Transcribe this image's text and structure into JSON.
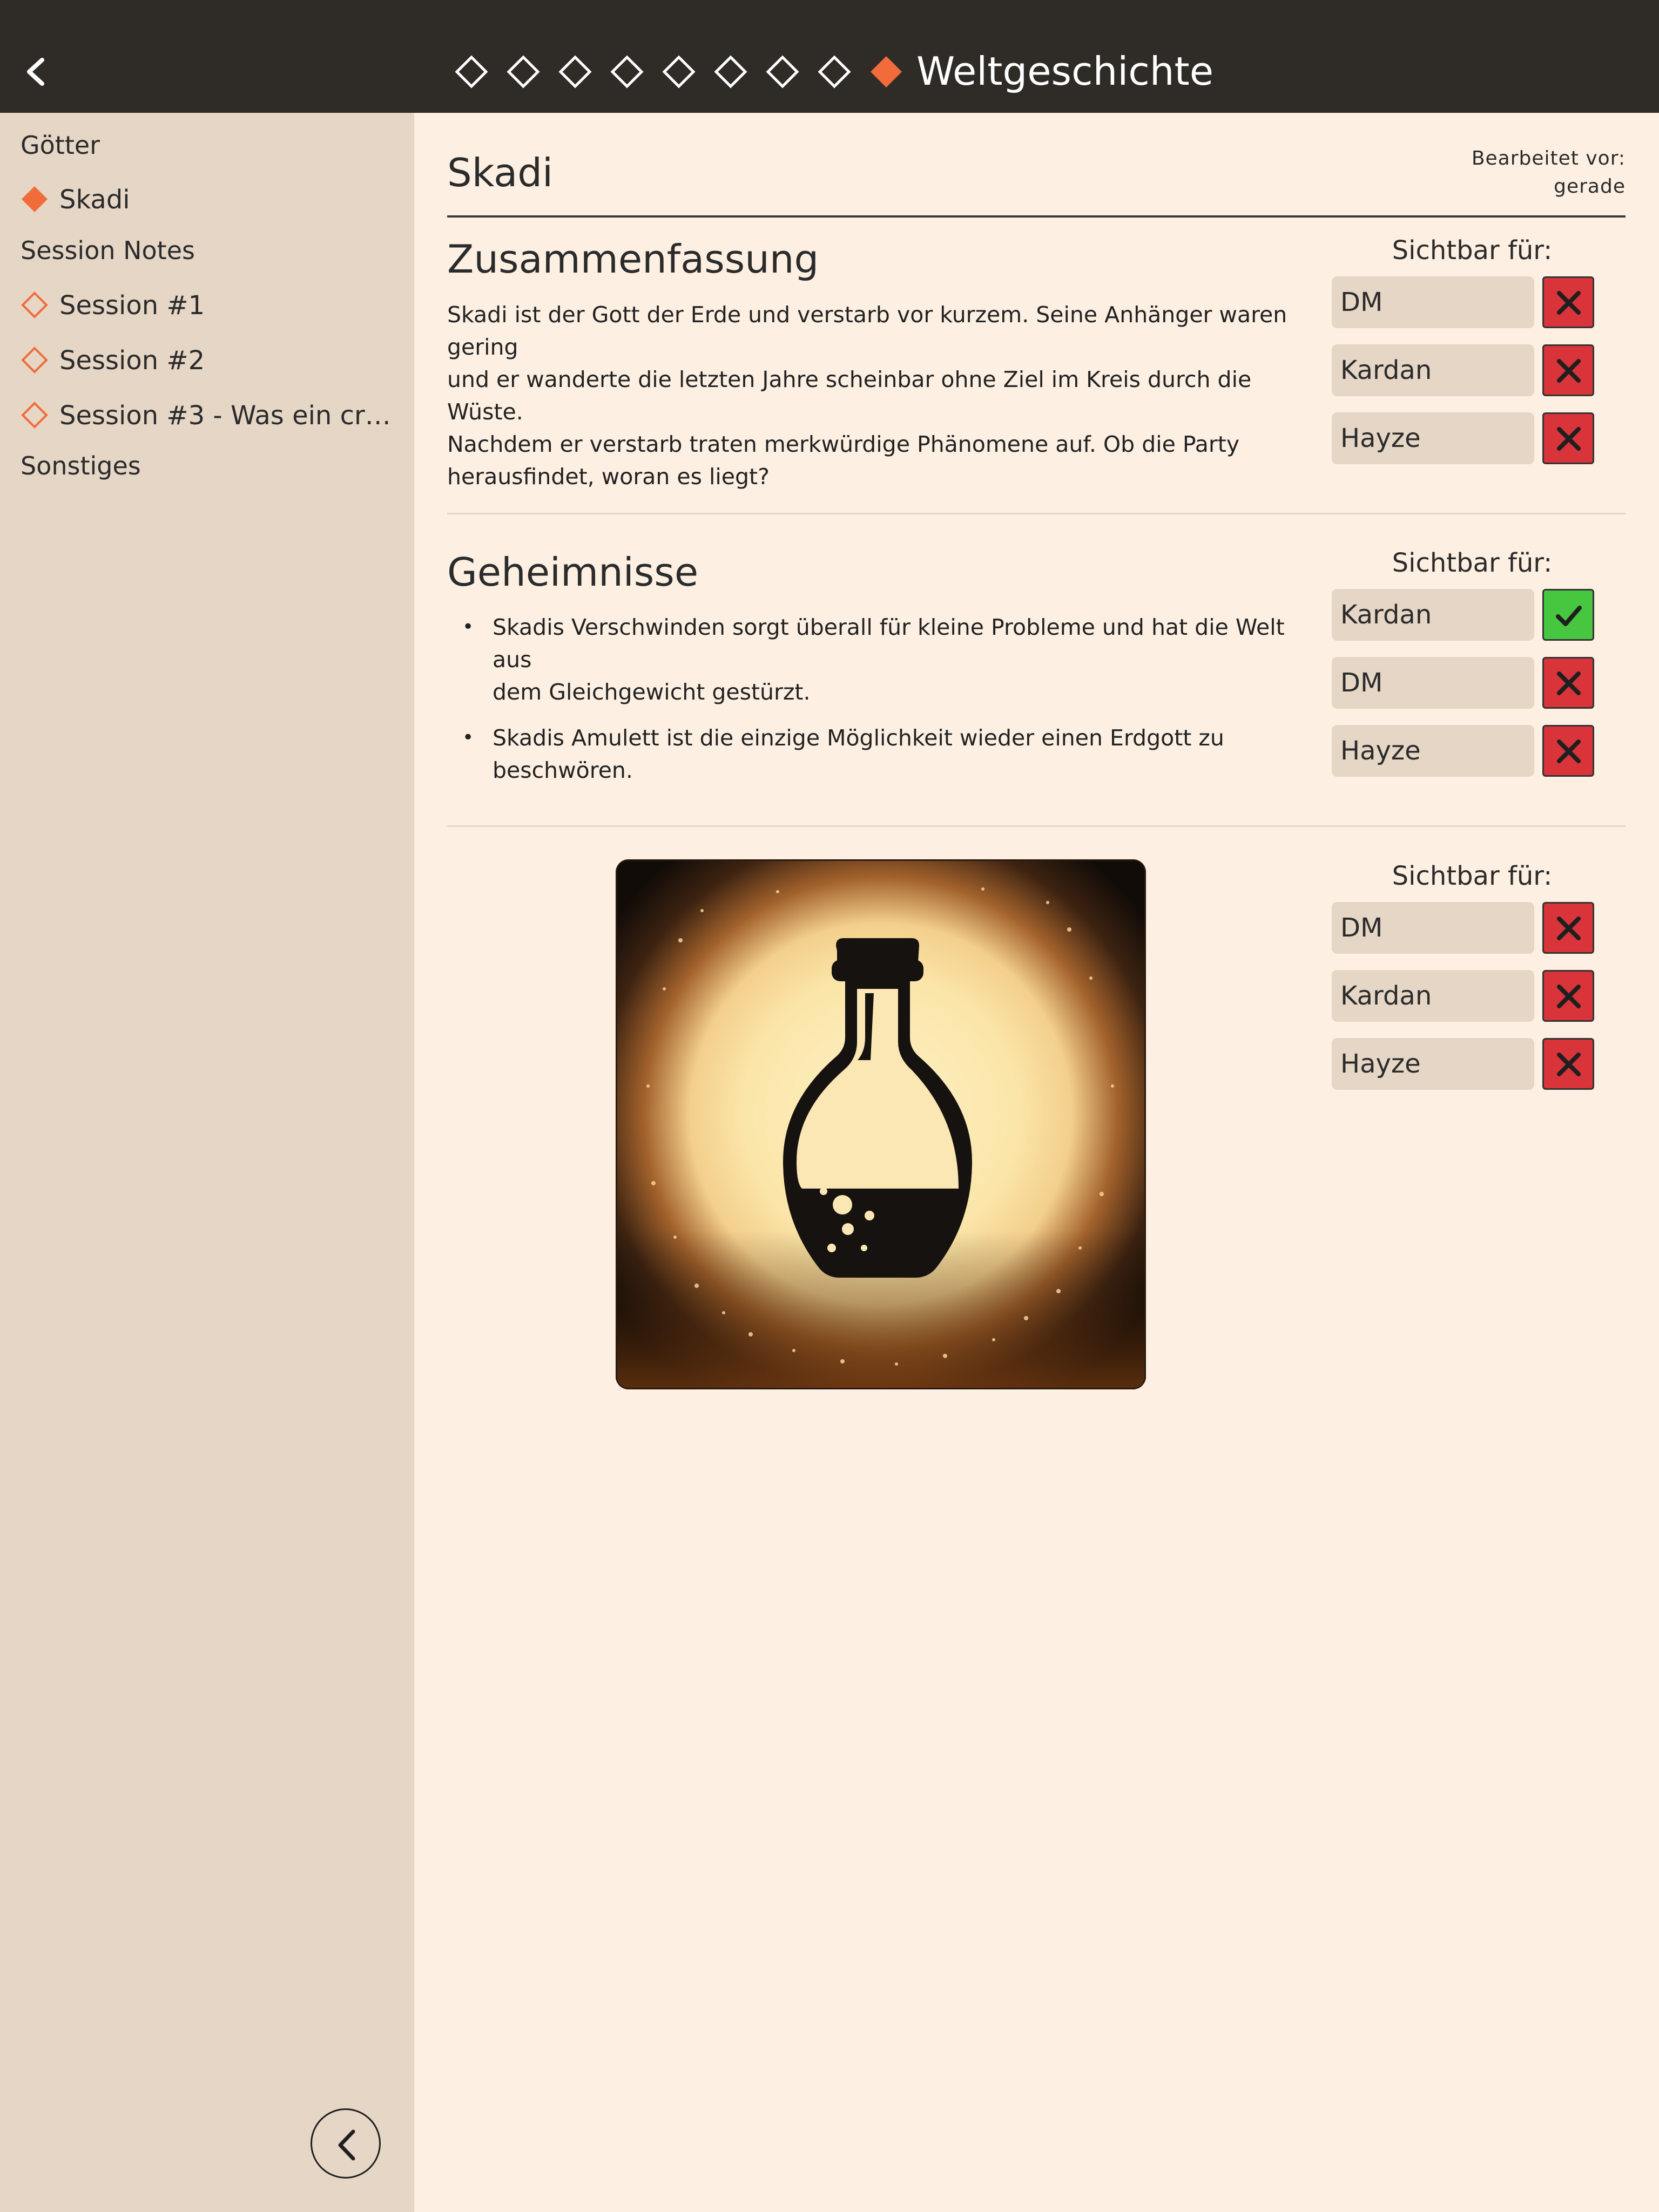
{
  "header": {
    "title": "Weltgeschichte",
    "diamonds": [
      "empty",
      "empty",
      "empty",
      "empty",
      "empty",
      "empty",
      "empty",
      "empty",
      "filled"
    ]
  },
  "sidebar": {
    "groups": [
      {
        "heading": "Götter",
        "items": [
          {
            "label": "Skadi",
            "active": true
          }
        ]
      },
      {
        "heading": "Session Notes",
        "items": [
          {
            "label": "Session #1",
            "active": false
          },
          {
            "label": "Session #2",
            "active": false
          },
          {
            "label": "Session #3 - Was ein crazy ri...",
            "active": false
          }
        ]
      },
      {
        "heading": "Sonstiges",
        "items": []
      }
    ]
  },
  "page": {
    "title": "Skadi",
    "edited_label": "Bearbeitet vor:",
    "edited_value": "gerade"
  },
  "sections": [
    {
      "title": "Zusammenfassung",
      "body_lines": [
        "Skadi ist der Gott der Erde und verstarb vor kurzem. Seine Anhänger waren gering",
        "und er wanderte die letzten Jahre scheinbar ohne Ziel im Kreis durch die Wüste.",
        "Nachdem er verstarb traten merkwürdige Phänomene auf. Ob die Party",
        "herausfindet, woran es liegt?"
      ],
      "visibility_label": "Sichtbar für:",
      "visibility": [
        {
          "name": "DM",
          "visible": false
        },
        {
          "name": "Kardan",
          "visible": false
        },
        {
          "name": "Hayze",
          "visible": false
        }
      ]
    },
    {
      "title": "Geheimnisse",
      "bullets": [
        {
          "line1": "Skadis Verschwinden sorgt überall für kleine Probleme und hat die Welt aus",
          "line2": "dem Gleichgewicht gestürzt."
        },
        {
          "line1": "Skadis Amulett ist die einzige Möglichkeit wieder einen Erdgott zu",
          "line2": "beschwören."
        }
      ],
      "bullet_char": "•",
      "visibility_label": "Sichtbar für:",
      "visibility": [
        {
          "name": "Kardan",
          "visible": true
        },
        {
          "name": "DM",
          "visible": false
        },
        {
          "name": "Hayze",
          "visible": false
        }
      ]
    },
    {
      "image": "potion-bottle-illustration",
      "visibility_label": "Sichtbar für:",
      "visibility": [
        {
          "name": "DM",
          "visible": false
        },
        {
          "name": "Kardan",
          "visible": false
        },
        {
          "name": "Hayze",
          "visible": false
        }
      ]
    }
  ],
  "colors": {
    "accent": "#f26b3a",
    "topbar": "#2f2b27",
    "sidebar": "#e5d6c6",
    "content": "#fdf0e3",
    "toggle_off": "#d8343a",
    "toggle_on": "#47c640"
  }
}
